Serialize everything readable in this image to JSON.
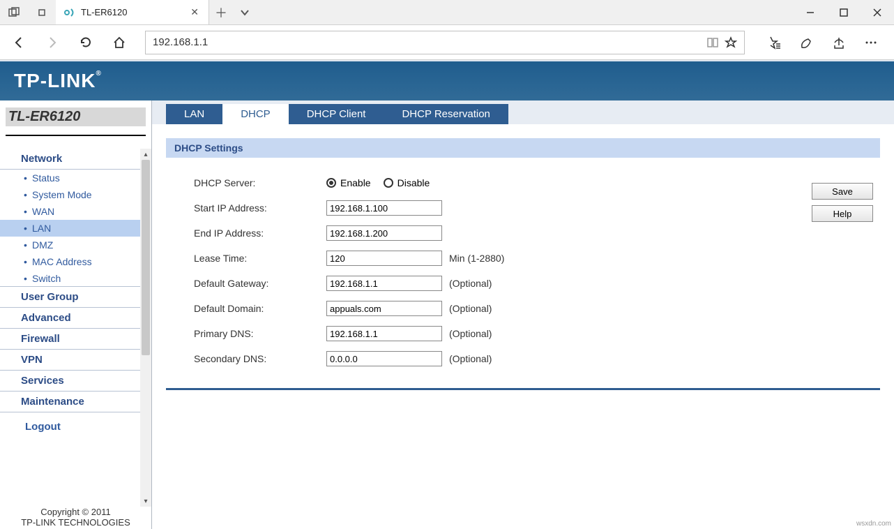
{
  "browser": {
    "tab_title": "TL-ER6120",
    "address": "192.168.1.1"
  },
  "logo_text": "TP-LINK",
  "model": "TL-ER6120",
  "sidebar": {
    "sections": {
      "network": "Network",
      "user_group": "User Group",
      "advanced": "Advanced",
      "firewall": "Firewall",
      "vpn": "VPN",
      "services": "Services",
      "maintenance": "Maintenance",
      "logout": "Logout"
    },
    "network_items": {
      "status": "Status",
      "system_mode": "System Mode",
      "wan": "WAN",
      "lan": "LAN",
      "dmz": "DMZ",
      "mac_address": "MAC Address",
      "switch": "Switch"
    },
    "footer": {
      "line1": "Copyright © 2011",
      "line2": "TP-LINK TECHNOLOGIES"
    }
  },
  "tabs": {
    "lan": "LAN",
    "dhcp": "DHCP",
    "dhcp_client": "DHCP Client",
    "dhcp_reservation": "DHCP Reservation"
  },
  "section_title": "DHCP Settings",
  "form": {
    "dhcp_server_label": "DHCP Server:",
    "enable": "Enable",
    "disable": "Disable",
    "start_ip_label": "Start IP Address:",
    "start_ip": "192.168.1.100",
    "end_ip_label": "End IP Address:",
    "end_ip": "192.168.1.200",
    "lease_label": "Lease Time:",
    "lease": "120",
    "lease_suffix": "Min (1-2880)",
    "gateway_label": "Default Gateway:",
    "gateway": "192.168.1.1",
    "domain_label": "Default Domain:",
    "domain": "appuals.com",
    "pdns_label": "Primary DNS:",
    "pdns": "192.168.1.1",
    "sdns_label": "Secondary DNS:",
    "sdns": "0.0.0.0",
    "optional": "(Optional)"
  },
  "buttons": {
    "save": "Save",
    "help": "Help"
  },
  "watermark": "wsxdn.com"
}
